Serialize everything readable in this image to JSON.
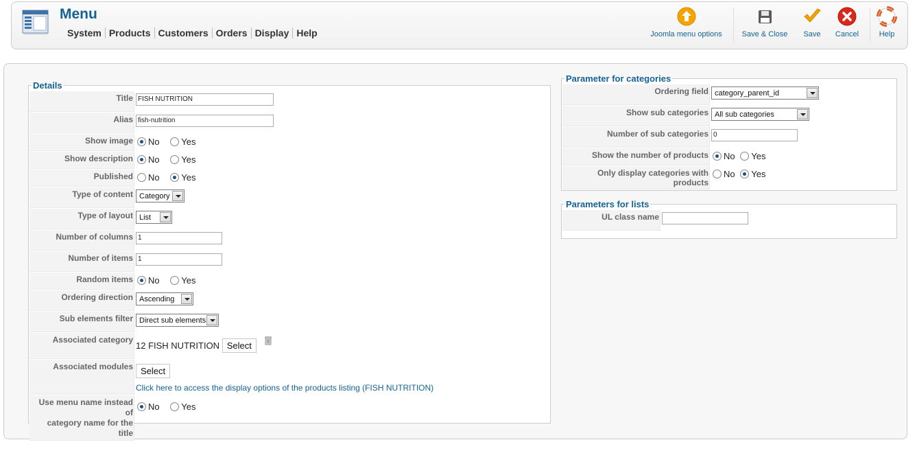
{
  "header": {
    "title": "Menu",
    "logo_icon": "menu-manager-icon",
    "nav": [
      "System",
      "Products",
      "Customers",
      "Orders",
      "Display",
      "Help"
    ]
  },
  "toolbar": {
    "joomla_options": "Joomla menu options",
    "save_close": "Save & Close",
    "save": "Save",
    "cancel": "Cancel",
    "help": "Help"
  },
  "details": {
    "legend": "Details",
    "title_label": "Title",
    "title_value": "FISH NUTRITION",
    "alias_label": "Alias",
    "alias_value": "fish-nutrition",
    "show_image_label": "Show image",
    "show_description_label": "Show description",
    "published_label": "Published",
    "type_content_label": "Type of content",
    "type_content_value": "Category",
    "type_layout_label": "Type of layout",
    "type_layout_value": "List",
    "num_columns_label": "Number of columns",
    "num_columns_value": "1",
    "num_items_label": "Number of items",
    "num_items_value": "1",
    "random_items_label": "Random items",
    "ordering_direction_label": "Ordering direction",
    "ordering_direction_value": "Ascending",
    "sub_filter_label": "Sub elements filter",
    "sub_filter_value": "Direct sub elements",
    "assoc_category_label": "Associated category",
    "assoc_category_value": "12 FISH NUTRITION",
    "assoc_modules_label": "Associated modules",
    "select_label": "Select",
    "display_options_link": "Click here to access the display options of the products listing (FISH NUTRITION)",
    "use_menu_name_label_1": "Use menu name instead of",
    "use_menu_name_label_2": "category name for the title",
    "no": "No",
    "yes": "Yes"
  },
  "categories": {
    "legend": "Parameter for categories",
    "ordering_field_label": "Ordering field",
    "ordering_field_value": "category_parent_id",
    "show_sub_label": "Show sub categories",
    "show_sub_value": "All sub categories",
    "num_sub_label": "Number of sub categories",
    "num_sub_value": "0",
    "show_num_products_label": "Show the number of products",
    "only_with_products_label": "Only display categories with products",
    "no": "No",
    "yes": "Yes"
  },
  "lists": {
    "legend": "Parameters for lists",
    "ul_class_label": "UL class name",
    "ul_class_value": ""
  },
  "colors": {
    "accent": "#146295",
    "panel_bg": "#f7f7f7",
    "key_bg": "#f3f3f3"
  }
}
